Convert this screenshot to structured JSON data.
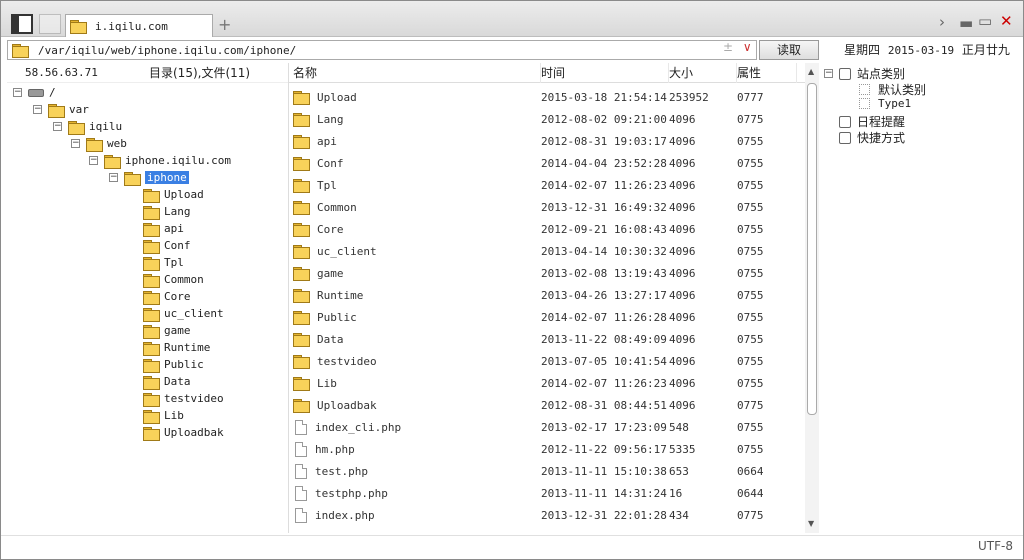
{
  "tab": {
    "title": "i.iqilu.com"
  },
  "address": {
    "path": "/var/iqilu/web/iphone.iqilu.com/iphone/",
    "read_button": "读取",
    "tools": "±",
    "dropdown": "∨"
  },
  "datebar": {
    "weekday": "星期四",
    "date": "2015-03-19",
    "lunar": "正月廿九"
  },
  "tree": {
    "ip": "58.56.63.71",
    "summary": "目录(15),文件(11)",
    "root": "/",
    "var": "var",
    "iqilu": "iqilu",
    "web": "web",
    "site": "iphone.iqilu.com",
    "selected": "iphone",
    "children": [
      "Upload",
      "Lang",
      "api",
      "Conf",
      "Tpl",
      "Common",
      "Core",
      "uc_client",
      "game",
      "Runtime",
      "Public",
      "Data",
      "testvideo",
      "Lib",
      "Uploadbak"
    ]
  },
  "list": {
    "headers": {
      "name": "名称",
      "time": "时间",
      "size": "大小",
      "attr": "属性"
    },
    "rows": [
      {
        "name": "Upload",
        "time": "2015-03-18 21:54:14",
        "size": "253952",
        "attr": "0777",
        "type": "folder"
      },
      {
        "name": "Lang",
        "time": "2012-08-02 09:21:00",
        "size": "4096",
        "attr": "0775",
        "type": "folder"
      },
      {
        "name": "api",
        "time": "2012-08-31 19:03:17",
        "size": "4096",
        "attr": "0755",
        "type": "folder"
      },
      {
        "name": "Conf",
        "time": "2014-04-04 23:52:28",
        "size": "4096",
        "attr": "0755",
        "type": "folder"
      },
      {
        "name": "Tpl",
        "time": "2014-02-07 11:26:23",
        "size": "4096",
        "attr": "0755",
        "type": "folder"
      },
      {
        "name": "Common",
        "time": "2013-12-31 16:49:32",
        "size": "4096",
        "attr": "0755",
        "type": "folder"
      },
      {
        "name": "Core",
        "time": "2012-09-21 16:08:43",
        "size": "4096",
        "attr": "0755",
        "type": "folder"
      },
      {
        "name": "uc_client",
        "time": "2013-04-14 10:30:32",
        "size": "4096",
        "attr": "0755",
        "type": "folder"
      },
      {
        "name": "game",
        "time": "2013-02-08 13:19:43",
        "size": "4096",
        "attr": "0755",
        "type": "folder"
      },
      {
        "name": "Runtime",
        "time": "2013-04-26 13:27:17",
        "size": "4096",
        "attr": "0755",
        "type": "folder"
      },
      {
        "name": "Public",
        "time": "2014-02-07 11:26:28",
        "size": "4096",
        "attr": "0755",
        "type": "folder"
      },
      {
        "name": "Data",
        "time": "2013-11-22 08:49:09",
        "size": "4096",
        "attr": "0755",
        "type": "folder"
      },
      {
        "name": "testvideo",
        "time": "2013-07-05 10:41:54",
        "size": "4096",
        "attr": "0755",
        "type": "folder"
      },
      {
        "name": "Lib",
        "time": "2014-02-07 11:26:23",
        "size": "4096",
        "attr": "0755",
        "type": "folder"
      },
      {
        "name": "Uploadbak",
        "time": "2012-08-31 08:44:51",
        "size": "4096",
        "attr": "0775",
        "type": "folder"
      },
      {
        "name": "index_cli.php",
        "time": "2013-02-17 17:23:09",
        "size": "548",
        "attr": "0755",
        "type": "file"
      },
      {
        "name": "hm.php",
        "time": "2012-11-22 09:56:17",
        "size": "5335",
        "attr": "0755",
        "type": "file"
      },
      {
        "name": "test.php",
        "time": "2013-11-11 15:10:38",
        "size": "653",
        "attr": "0664",
        "type": "file"
      },
      {
        "name": "testphp.php",
        "time": "2013-11-11 14:31:24",
        "size": "16",
        "attr": "0644",
        "type": "file"
      },
      {
        "name": "index.php",
        "time": "2013-12-31 22:01:28",
        "size": "434",
        "attr": "0775",
        "type": "file"
      }
    ]
  },
  "sidebar": {
    "site_category": "站点类别",
    "default_category": "默认类别",
    "type1": "Type1",
    "schedule": "日程提醒",
    "shortcuts": "快捷方式"
  },
  "status": {
    "encoding": "UTF-8"
  },
  "colors": {
    "selection": "#3a7fe3",
    "folder": "#f8d25a",
    "close": "#cc0000"
  }
}
